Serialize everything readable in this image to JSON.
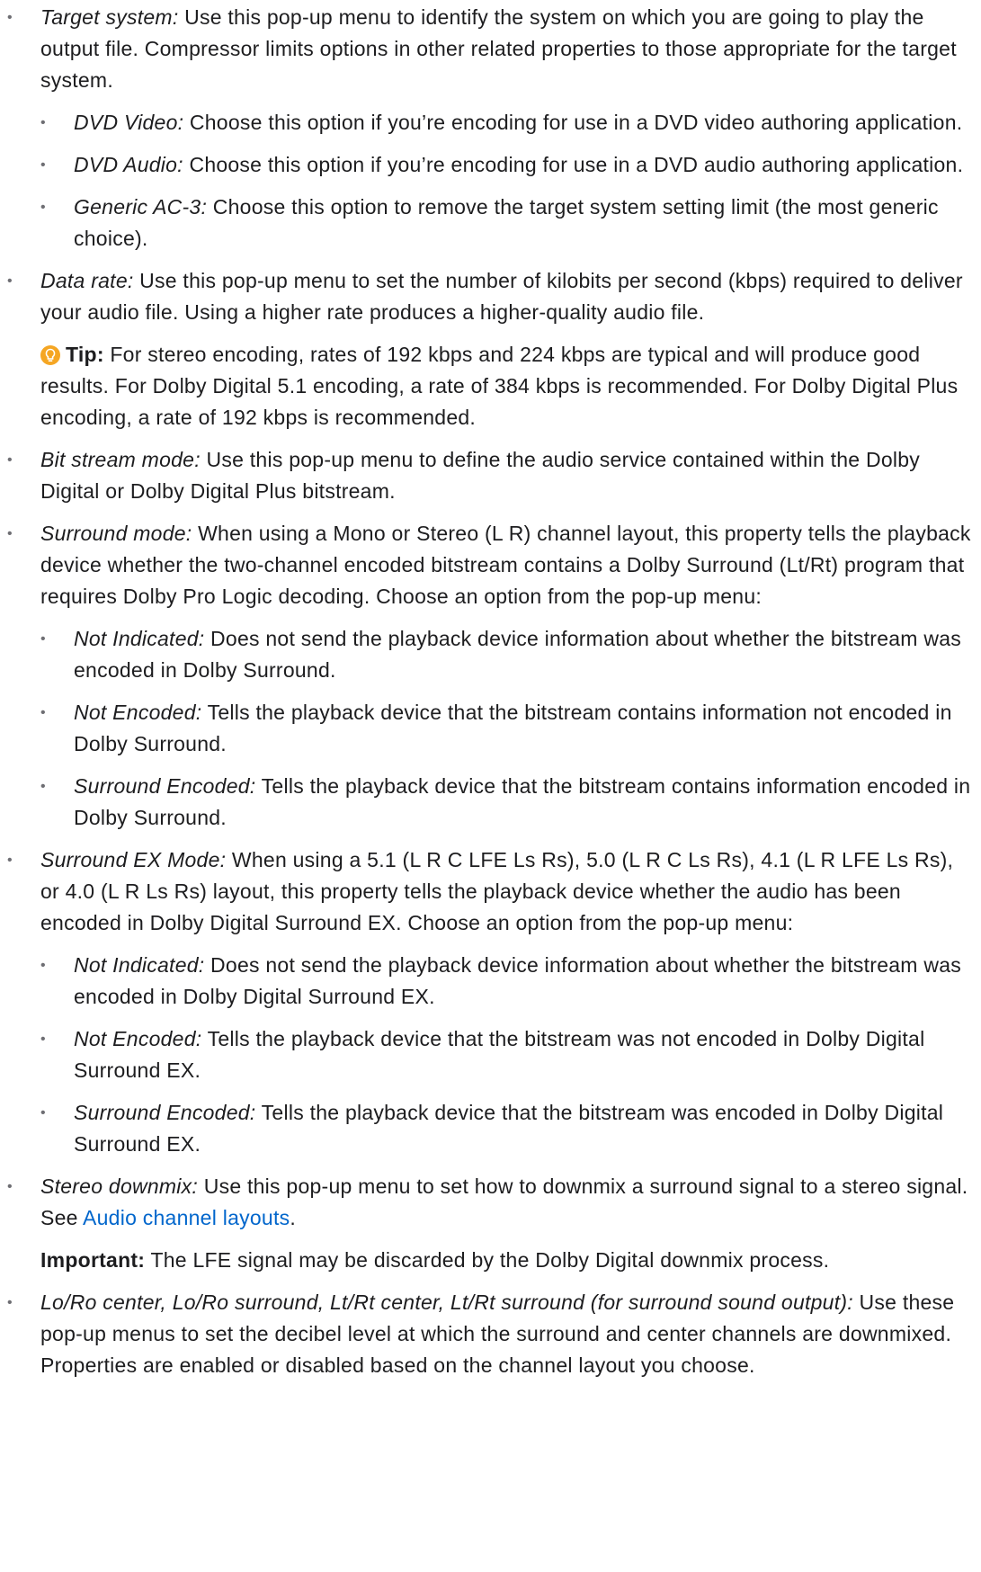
{
  "items": [
    {
      "term": "Target system:",
      "text": " Use this pop-up menu to identify the system on which you are going to play the output file. Compressor limits options in other related properties to those appropriate for the target system.",
      "sub": [
        {
          "term": "DVD Video:",
          "text": " Choose this option if you’re encoding for use in a DVD video authoring application."
        },
        {
          "term": "DVD Audio:",
          "text": " Choose this option if you’re encoding for use in a DVD audio authoring application."
        },
        {
          "term": "Generic AC-3:",
          "text": " Choose this option to remove the target system setting limit (the most generic choice)."
        }
      ]
    },
    {
      "term": "Data rate:",
      "text": " Use this pop-up menu to set the number of kilobits per second (kbps) required to deliver your audio file. Using a higher rate produces a higher-quality audio file.",
      "tip": {
        "icon": "lightbulb-icon",
        "label": "Tip:",
        "text": " For stereo encoding, rates of 192 kbps and 224 kbps are typical and will produce good results. For Dolby Digital 5.1 encoding, a rate of 384 kbps is recommended. For Dolby Digital Plus encoding, a rate of 192 kbps is recommended."
      }
    },
    {
      "term": "Bit stream mode:",
      "text": " Use this pop-up menu to define the audio service contained within the Dolby Digital or Dolby Digital Plus bitstream."
    },
    {
      "term": "Surround mode:",
      "text": " When using a Mono or Stereo (L R) channel layout, this property tells the playback device whether the two-channel encoded bitstream contains a Dolby Surround (Lt/Rt) program that requires Dolby Pro Logic decoding. Choose an option from the pop-up menu:",
      "sub": [
        {
          "term": "Not Indicated:",
          "text": " Does not send the playback device information about whether the bitstream was encoded in Dolby Surround."
        },
        {
          "term": "Not Encoded:",
          "text": " Tells the playback device that the bitstream contains information not encoded in Dolby Surround."
        },
        {
          "term": "Surround Encoded:",
          "text": " Tells the playback device that the bitstream contains information encoded in Dolby Surround."
        }
      ]
    },
    {
      "term": "Surround EX Mode:",
      "text": " When using a 5.1 (L R C LFE Ls Rs), 5.0 (L R C Ls Rs), 4.1 (L R LFE Ls Rs), or 4.0 (L R Ls Rs) layout, this property tells the playback device whether the audio has been encoded in Dolby Digital Surround EX. Choose an option from the pop-up menu:",
      "sub": [
        {
          "term": "Not Indicated:",
          "text": " Does not send the playback device information about whether the bitstream was encoded in Dolby Digital Surround EX."
        },
        {
          "term": "Not Encoded:",
          "text": " Tells the playback device that the bitstream was not encoded in Dolby Digital Surround EX."
        },
        {
          "term": "Surround Encoded:",
          "text": " Tells the playback device that the bitstream was encoded in Dolby Digital Surround EX."
        }
      ]
    },
    {
      "term": "Stereo downmix:",
      "text": " Use this pop-up menu to set how to downmix a surround signal to a stereo signal. See ",
      "link": "Audio channel layouts",
      "after": ".",
      "note": {
        "label": "Important:",
        "text": " The LFE signal may be discarded by the Dolby Digital downmix process."
      }
    },
    {
      "term": "Lo/Ro center, Lo/Ro surround, Lt/Rt center, Lt/Rt surround (for surround sound output):",
      "text": " Use these pop-up menus to set the decibel level at which the surround and center channels are downmixed. Properties are enabled or disabled based on the channel layout you choose."
    }
  ],
  "colors": {
    "text": "#1d1d1f",
    "link": "#0066cc",
    "tip_icon": "#f5a623"
  }
}
